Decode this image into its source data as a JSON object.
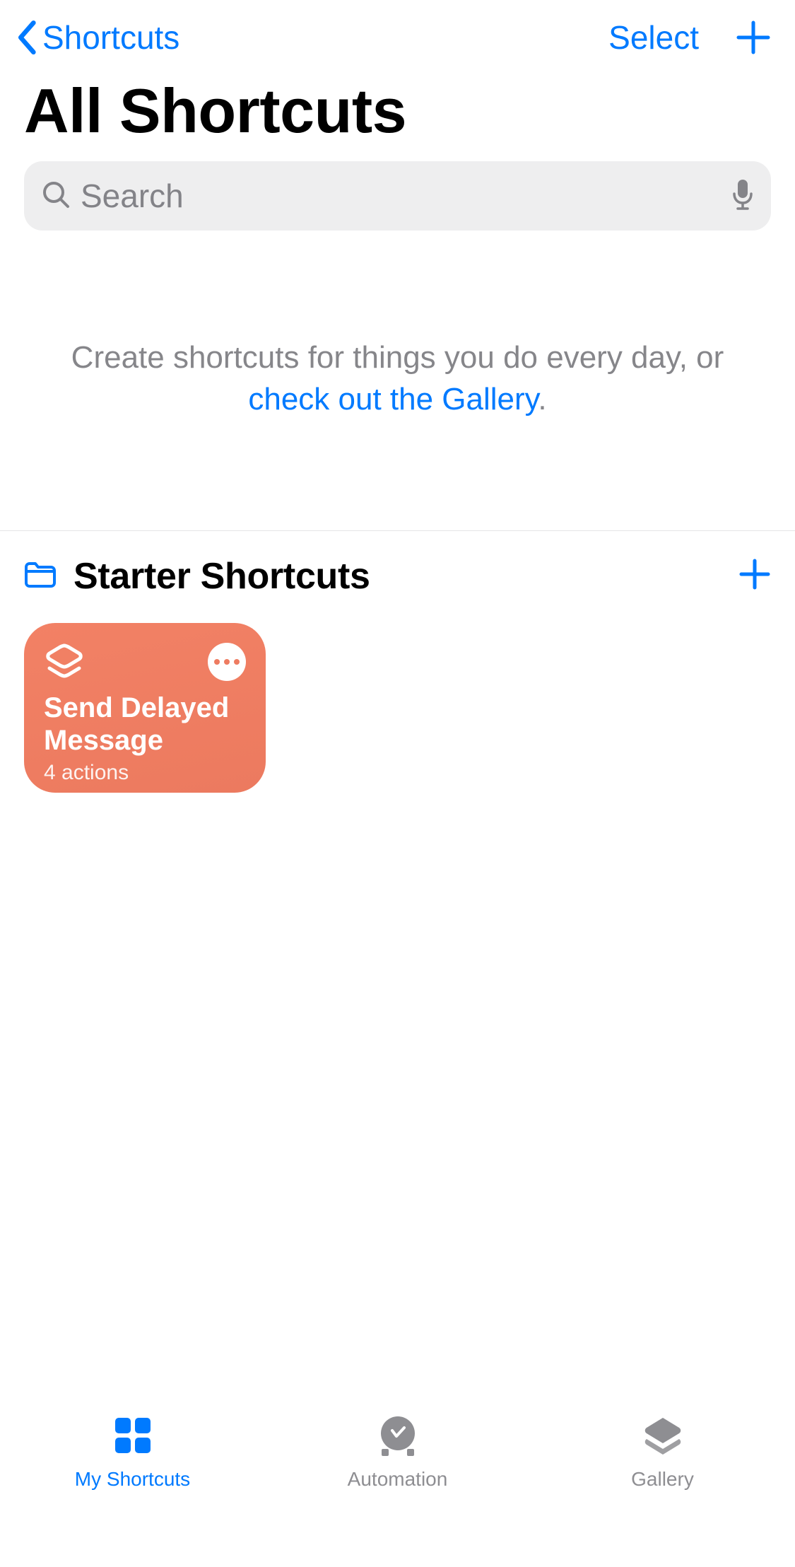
{
  "nav": {
    "back_label": "Shortcuts",
    "select_label": "Select"
  },
  "title": "All Shortcuts",
  "search": {
    "placeholder": "Search"
  },
  "empty": {
    "line1": "Create shortcuts for things you do every day, or",
    "link": "check out the Gallery",
    "period": "."
  },
  "section": {
    "title": "Starter Shortcuts"
  },
  "shortcuts": {
    "card": {
      "title": "Send Delayed Message",
      "subtitle": "4 actions"
    }
  },
  "tabs": {
    "my_shortcuts": "My Shortcuts",
    "automation": "Automation",
    "gallery": "Gallery"
  }
}
